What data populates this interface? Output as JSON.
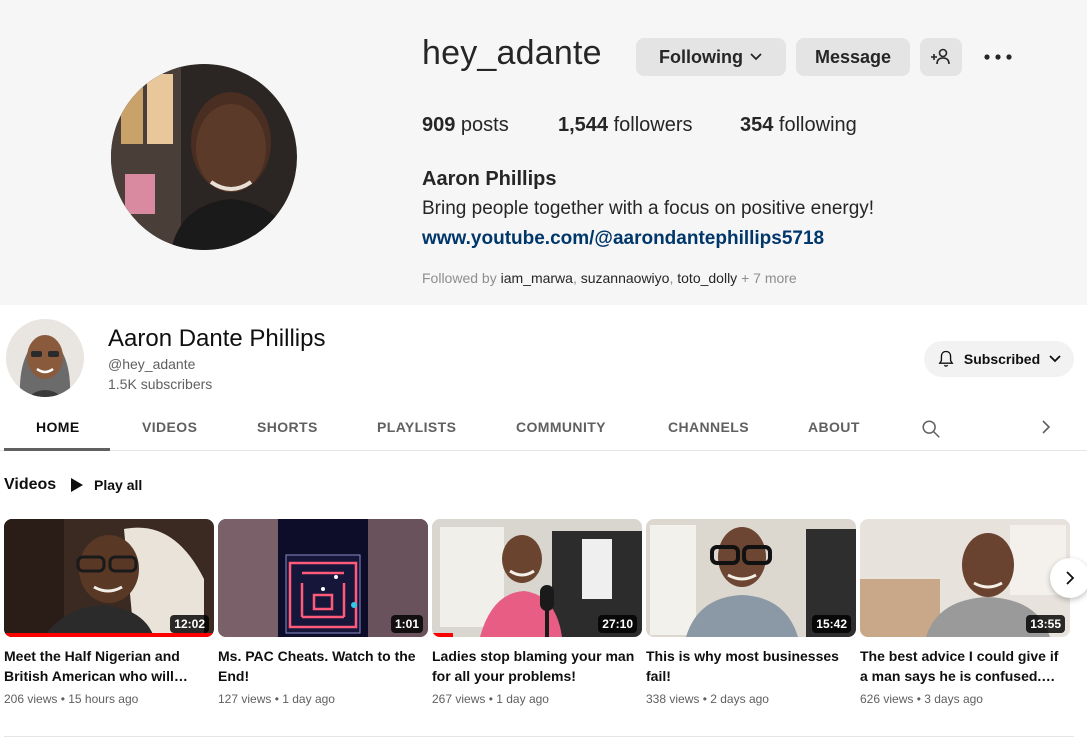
{
  "instagram": {
    "username": "hey_adante",
    "following_label": "Following",
    "message_label": "Message",
    "stats": {
      "posts_count": "909",
      "posts_label": " posts",
      "followers_count": "1,544",
      "followers_label": " followers",
      "following_count": "354",
      "following_label": " following"
    },
    "full_name": "Aaron Phillips",
    "bio": "Bring people together with a focus on positive energy!",
    "link": "www.youtube.com/@aarondantephillips5718",
    "followed_by_prefix": "Followed by ",
    "followed_by_users": [
      "iam_marwa",
      "suzannaowiyo",
      "toto_dolly"
    ],
    "followed_by_more": " + 7 more"
  },
  "youtube": {
    "channel_name": "Aaron Dante Phillips",
    "handle": "@hey_adante",
    "subscribers": "1.5K subscribers",
    "subscribed_label": "Subscribed",
    "tabs": [
      "HOME",
      "VIDEOS",
      "SHORTS",
      "PLAYLISTS",
      "COMMUNITY",
      "CHANNELS",
      "ABOUT"
    ],
    "active_tab": "HOME",
    "section_title": "Videos",
    "play_all_label": "Play all",
    "videos": [
      {
        "title": "Meet the Half Nigerian and British American who will…",
        "duration": "12:02",
        "views": "206 views",
        "age": "15 hours ago",
        "watched_fraction": 1.0
      },
      {
        "title": "Ms. PAC Cheats. Watch to the End!",
        "duration": "1:01",
        "views": "127 views",
        "age": "1 day ago",
        "watched_fraction": 0
      },
      {
        "title": "Ladies stop blaming your man for all your problems!",
        "duration": "27:10",
        "views": "267 views",
        "age": "1 day ago",
        "watched_fraction": 0.1
      },
      {
        "title": "This is why most businesses fail!",
        "duration": "15:42",
        "views": "338 views",
        "age": "2 days ago",
        "watched_fraction": 0
      },
      {
        "title": "The best advice I could give if a man says he is confused.…",
        "duration": "13:55",
        "views": "626 views",
        "age": "3 days ago",
        "watched_fraction": 0
      }
    ],
    "meta_separator": " • "
  },
  "colors": {
    "ig_background": "#f6f6f6",
    "ig_link": "#00376b",
    "yt_progress": "#ff0000",
    "yt_secondary_text": "#606060"
  }
}
